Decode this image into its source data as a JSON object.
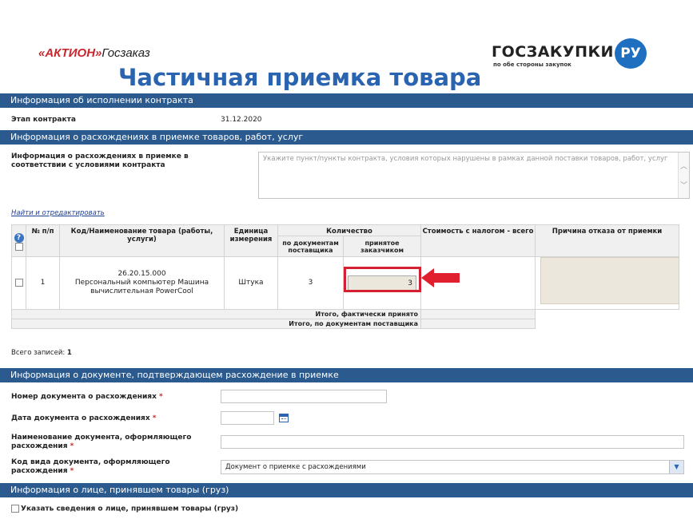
{
  "header": {
    "aktion_logo_red": "«АКТИОН»",
    "aktion_logo_dark": "Госзаказ",
    "gz_logo_text": "ГОСЗАКУПКИ",
    "gz_logo_circle": "РУ",
    "gz_logo_sub": "по обе стороны закупок",
    "title": "Частичная приемка товара"
  },
  "sections": {
    "contract_info": "Информация об исполнении контракта",
    "discrepancy_info": "Информация о расхождениях в приемке товаров, работ, услуг",
    "document_info": "Информация о документе, подтверждающем расхождение в приемке",
    "person_info": "Информация о лице, принявшем товары (груз)"
  },
  "contract": {
    "stage_label": "Этап контракта",
    "stage_value": "31.12.2020"
  },
  "discrepancy": {
    "label": "Информация о расхождениях в приемке в соответствии с условиями контракта",
    "placeholder": "Укажите пункт/пункты контракта, условия которых нарушены в рамках данной поставки товаров, работ, услуг",
    "find_link": "Найти и отредактировать"
  },
  "table": {
    "headers": {
      "help": "?",
      "num": "№ п/п",
      "code_name": "Код/Наименование товара (работы, услуги)",
      "unit": "Единица измерения",
      "quantity": "Количество",
      "qty_by_docs": "по документам поставщика",
      "qty_accepted": "принятое заказчиком",
      "cost": "Стоимость с налогом - всего",
      "reason": "Причина отказа от приемки"
    },
    "rows": [
      {
        "num": "1",
        "code": "26.20.15.000",
        "name": "Персональный компьютер Машина вычислительная PowerCool",
        "unit": "Штука",
        "qty_docs": "3",
        "qty_accepted": "3"
      }
    ],
    "summary_actual": "Итого, фактически принято",
    "summary_docs": "Итого, по документам поставщика"
  },
  "records": {
    "label": "Всего записей:",
    "count": "1"
  },
  "document_form": {
    "number_label": "Номер документа о расхождениях",
    "date_label": "Дата документа о расхождениях",
    "name_label_1": "Наименование документа, оформляющего",
    "name_label_2": "расхождения",
    "kind_label_1": "Код вида документа, оформляющего",
    "kind_label_2": "расхождения",
    "kind_value": "Документ о приемке с расхождениями",
    "required_mark": "*"
  },
  "person": {
    "checkbox_label": "Указать сведения о лице, принявшем товары (груз)"
  },
  "colors": {
    "section_bar": "#2b5a8e",
    "title": "#2a64b0",
    "highlight": "#d42030"
  }
}
